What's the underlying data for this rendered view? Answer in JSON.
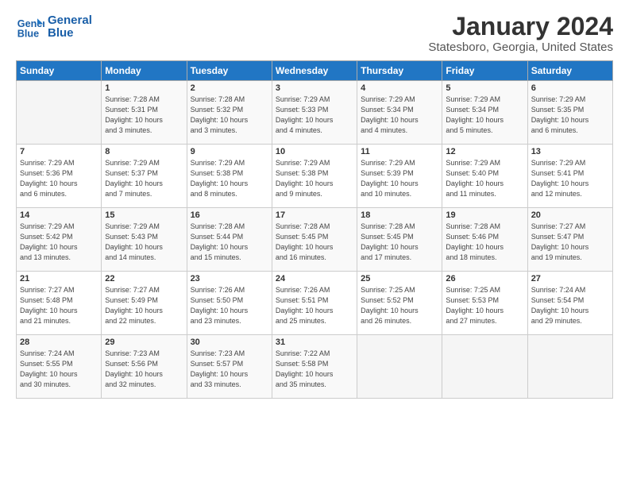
{
  "header": {
    "logo_line1": "General",
    "logo_line2": "Blue",
    "month_title": "January 2024",
    "location": "Statesboro, Georgia, United States"
  },
  "days_of_week": [
    "Sunday",
    "Monday",
    "Tuesday",
    "Wednesday",
    "Thursday",
    "Friday",
    "Saturday"
  ],
  "weeks": [
    [
      {
        "num": "",
        "info": ""
      },
      {
        "num": "1",
        "info": "Sunrise: 7:28 AM\nSunset: 5:31 PM\nDaylight: 10 hours\nand 3 minutes."
      },
      {
        "num": "2",
        "info": "Sunrise: 7:28 AM\nSunset: 5:32 PM\nDaylight: 10 hours\nand 3 minutes."
      },
      {
        "num": "3",
        "info": "Sunrise: 7:29 AM\nSunset: 5:33 PM\nDaylight: 10 hours\nand 4 minutes."
      },
      {
        "num": "4",
        "info": "Sunrise: 7:29 AM\nSunset: 5:34 PM\nDaylight: 10 hours\nand 4 minutes."
      },
      {
        "num": "5",
        "info": "Sunrise: 7:29 AM\nSunset: 5:34 PM\nDaylight: 10 hours\nand 5 minutes."
      },
      {
        "num": "6",
        "info": "Sunrise: 7:29 AM\nSunset: 5:35 PM\nDaylight: 10 hours\nand 6 minutes."
      }
    ],
    [
      {
        "num": "7",
        "info": "Sunrise: 7:29 AM\nSunset: 5:36 PM\nDaylight: 10 hours\nand 6 minutes."
      },
      {
        "num": "8",
        "info": "Sunrise: 7:29 AM\nSunset: 5:37 PM\nDaylight: 10 hours\nand 7 minutes."
      },
      {
        "num": "9",
        "info": "Sunrise: 7:29 AM\nSunset: 5:38 PM\nDaylight: 10 hours\nand 8 minutes."
      },
      {
        "num": "10",
        "info": "Sunrise: 7:29 AM\nSunset: 5:38 PM\nDaylight: 10 hours\nand 9 minutes."
      },
      {
        "num": "11",
        "info": "Sunrise: 7:29 AM\nSunset: 5:39 PM\nDaylight: 10 hours\nand 10 minutes."
      },
      {
        "num": "12",
        "info": "Sunrise: 7:29 AM\nSunset: 5:40 PM\nDaylight: 10 hours\nand 11 minutes."
      },
      {
        "num": "13",
        "info": "Sunrise: 7:29 AM\nSunset: 5:41 PM\nDaylight: 10 hours\nand 12 minutes."
      }
    ],
    [
      {
        "num": "14",
        "info": "Sunrise: 7:29 AM\nSunset: 5:42 PM\nDaylight: 10 hours\nand 13 minutes."
      },
      {
        "num": "15",
        "info": "Sunrise: 7:29 AM\nSunset: 5:43 PM\nDaylight: 10 hours\nand 14 minutes."
      },
      {
        "num": "16",
        "info": "Sunrise: 7:28 AM\nSunset: 5:44 PM\nDaylight: 10 hours\nand 15 minutes."
      },
      {
        "num": "17",
        "info": "Sunrise: 7:28 AM\nSunset: 5:45 PM\nDaylight: 10 hours\nand 16 minutes."
      },
      {
        "num": "18",
        "info": "Sunrise: 7:28 AM\nSunset: 5:45 PM\nDaylight: 10 hours\nand 17 minutes."
      },
      {
        "num": "19",
        "info": "Sunrise: 7:28 AM\nSunset: 5:46 PM\nDaylight: 10 hours\nand 18 minutes."
      },
      {
        "num": "20",
        "info": "Sunrise: 7:27 AM\nSunset: 5:47 PM\nDaylight: 10 hours\nand 19 minutes."
      }
    ],
    [
      {
        "num": "21",
        "info": "Sunrise: 7:27 AM\nSunset: 5:48 PM\nDaylight: 10 hours\nand 21 minutes."
      },
      {
        "num": "22",
        "info": "Sunrise: 7:27 AM\nSunset: 5:49 PM\nDaylight: 10 hours\nand 22 minutes."
      },
      {
        "num": "23",
        "info": "Sunrise: 7:26 AM\nSunset: 5:50 PM\nDaylight: 10 hours\nand 23 minutes."
      },
      {
        "num": "24",
        "info": "Sunrise: 7:26 AM\nSunset: 5:51 PM\nDaylight: 10 hours\nand 25 minutes."
      },
      {
        "num": "25",
        "info": "Sunrise: 7:25 AM\nSunset: 5:52 PM\nDaylight: 10 hours\nand 26 minutes."
      },
      {
        "num": "26",
        "info": "Sunrise: 7:25 AM\nSunset: 5:53 PM\nDaylight: 10 hours\nand 27 minutes."
      },
      {
        "num": "27",
        "info": "Sunrise: 7:24 AM\nSunset: 5:54 PM\nDaylight: 10 hours\nand 29 minutes."
      }
    ],
    [
      {
        "num": "28",
        "info": "Sunrise: 7:24 AM\nSunset: 5:55 PM\nDaylight: 10 hours\nand 30 minutes."
      },
      {
        "num": "29",
        "info": "Sunrise: 7:23 AM\nSunset: 5:56 PM\nDaylight: 10 hours\nand 32 minutes."
      },
      {
        "num": "30",
        "info": "Sunrise: 7:23 AM\nSunset: 5:57 PM\nDaylight: 10 hours\nand 33 minutes."
      },
      {
        "num": "31",
        "info": "Sunrise: 7:22 AM\nSunset: 5:58 PM\nDaylight: 10 hours\nand 35 minutes."
      },
      {
        "num": "",
        "info": ""
      },
      {
        "num": "",
        "info": ""
      },
      {
        "num": "",
        "info": ""
      }
    ]
  ]
}
